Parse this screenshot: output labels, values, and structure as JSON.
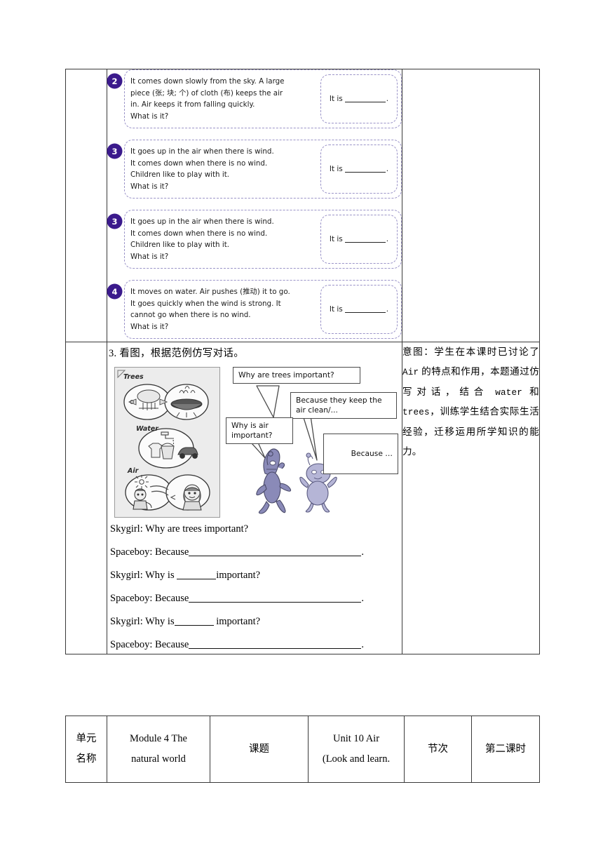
{
  "riddles": [
    {
      "number": "2",
      "lines": [
        "It comes down slowly from the sky. A large",
        "piece (张; 块; 个) of cloth (布) keeps the air",
        "in. Air keeps it from falling quickly.",
        "What is it?"
      ],
      "answer_prefix": "It is",
      "answer_suffix": "."
    },
    {
      "number": "3",
      "lines": [
        "It goes up in the air when there is wind.",
        "It comes down when there is no wind.",
        "Children like to play with it.",
        "What is it?"
      ],
      "answer_prefix": "It is",
      "answer_suffix": "."
    },
    {
      "number": "3",
      "lines": [
        "It goes up in the air when there is wind.",
        "It comes down when there is no wind.",
        "Children like to play with it.",
        "What is it?"
      ],
      "answer_prefix": "It is",
      "answer_suffix": "."
    },
    {
      "number": "4",
      "lines": [
        "It moves on water. Air pushes (推动) it to go.",
        "It goes quickly when the wind is strong. It",
        "cannot go when there is no wind.",
        "What is it?"
      ],
      "answer_prefix": "It is",
      "answer_suffix": "."
    }
  ],
  "section3": {
    "title": "3. 看图，根据范例仿写对话。",
    "picture": {
      "labels": [
        "Trees",
        "Water",
        "Air"
      ]
    },
    "bubbles": [
      {
        "id": "b1",
        "text": "Why are trees important?"
      },
      {
        "id": "b2",
        "text": "Because they keep the air clean/..."
      },
      {
        "id": "b3",
        "text": "Why is air important?"
      },
      {
        "id": "b4",
        "text": "Because …"
      }
    ],
    "dialogue": [
      {
        "speaker": "Skygirl:",
        "text": "Why are trees important?",
        "blanks": "none"
      },
      {
        "speaker": "Spaceboy:",
        "text": "Because",
        "blanks": "long",
        "tail": "."
      },
      {
        "speaker": "Skygirl:",
        "text": "Why is",
        "blanks": "mid",
        "tail": "important?"
      },
      {
        "speaker": "Spaceboy:",
        "text": "Because",
        "blanks": "long",
        "tail": "."
      },
      {
        "speaker": "Skygirl:",
        "text": "Why is",
        "blanks": "mid",
        "tail": " important?"
      },
      {
        "speaker": "Spaceboy:",
        "text": "Because",
        "blanks": "long",
        "tail": "."
      }
    ]
  },
  "note": {
    "text_parts": [
      "意图：学生在本课时已讨论了 ",
      "Air",
      " 的特点和作用，本题通过仿写对话，结合 ",
      "water",
      " 和 ",
      "trees",
      "，训练学生结合实际生活经验，迁移运用所学知识的能力。"
    ],
    "full_text": "意图：学生在本课时已讨论了 Air 的特点和作用，本题通过仿写对话，结合 water 和 trees，训练学生结合实际生活经验，迁移运用所学知识的能力。"
  },
  "footer": {
    "unit_label_line1": "单元",
    "unit_label_line2": "名称",
    "unit_value_line1": "Module 4 The",
    "unit_value_line2": "natural world",
    "topic_label": "课题",
    "topic_value_line1": "Unit 10 Air",
    "topic_value_line2": "(Look and learn.",
    "period_label": "节次",
    "period_value": "第二课时"
  },
  "colors": {
    "badge_purple": "#3b1a8c",
    "dashed_border": "#9a93c8",
    "table_border": "#3a3a3a",
    "alien_body": "#8a8ab8",
    "alien_light": "#b5b5d6"
  }
}
